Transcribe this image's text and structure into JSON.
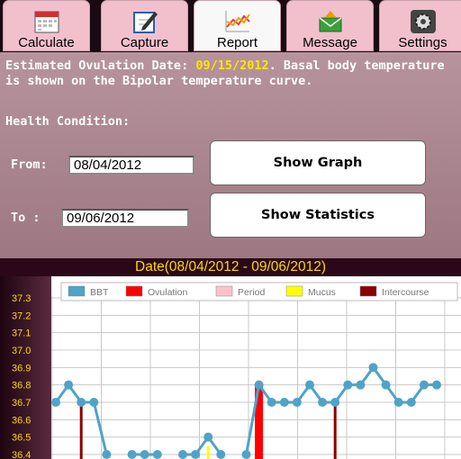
{
  "tabs": [
    {
      "label": "Calculate",
      "icon": "calendar-icon",
      "active": false
    },
    {
      "label": "Capture",
      "icon": "edit-icon",
      "active": false
    },
    {
      "label": "Report",
      "icon": "line-chart-icon",
      "active": true
    },
    {
      "label": "Message",
      "icon": "mail-icon",
      "active": false
    },
    {
      "label": "Settings",
      "icon": "gear-icon",
      "active": false
    }
  ],
  "info": {
    "prefix": "Estimated  Ovulation  Date: ",
    "date": "09/15/2012",
    "suffix": ".  Basal  body temperature is shown on the Bipolar temperature curve.",
    "health": "Health Condition:"
  },
  "form": {
    "from_label": "From:",
    "from_value": "08/04/2012",
    "to_label": "To  :",
    "to_value": "09/06/2012",
    "show_graph": "Show Graph",
    "show_stats": "Show Statistics"
  },
  "colors": {
    "bbt": "#4fa3c7",
    "ovulation": "#ff0000",
    "period": "#ffc0cb",
    "mucus": "#ffff00",
    "intercourse": "#8b0000"
  },
  "chart_data": {
    "type": "line",
    "title": "Date(08/04/2012 - 09/06/2012)",
    "y_ticks": [
      "36.4",
      "36.5",
      "36.6",
      "36.7",
      "36.8",
      "36.9",
      "37.0",
      "37.1",
      "37.2",
      "37.3"
    ],
    "ylim": [
      36.4,
      37.33
    ],
    "legend": [
      "BBT",
      "Ovulation",
      "Period",
      "Mucus",
      "Intercourse"
    ],
    "legend_position": "top",
    "grid": true,
    "series": [
      {
        "name": "BBT",
        "values": [
          36.7,
          36.8,
          36.7,
          36.7,
          36.4,
          null,
          36.4,
          36.4,
          36.4,
          null,
          36.4,
          36.4,
          36.5,
          36.4,
          null,
          36.4,
          36.8,
          36.7,
          36.7,
          36.7,
          36.8,
          36.7,
          36.7,
          36.8,
          36.8,
          36.9,
          36.8,
          36.7,
          36.7,
          36.8,
          36.8
        ]
      }
    ],
    "bars": [
      {
        "type": "Intercourse",
        "index": 2,
        "value": 36.7
      },
      {
        "type": "Mucus",
        "index": 12,
        "value": 36.45
      },
      {
        "type": "Ovulation",
        "index": 16,
        "value": 36.8
      },
      {
        "type": "Intercourse",
        "index": 22,
        "value": 36.7
      }
    ]
  }
}
